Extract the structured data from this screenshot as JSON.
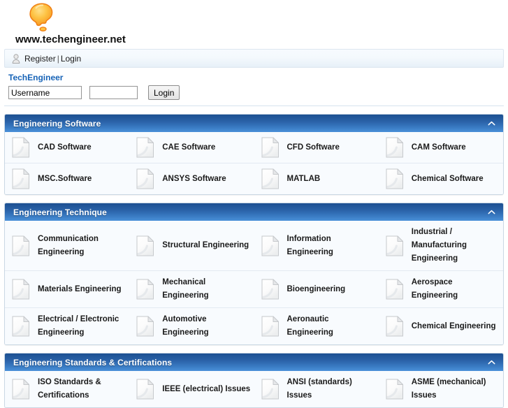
{
  "site": {
    "name": "www.techengineer.net",
    "logo_icon": "lightbulb-speech-bubble-logo",
    "brand_color": "#f7941e"
  },
  "account_bar": {
    "user_icon": "user-icon",
    "register_label": "Register",
    "separator": "|",
    "login_label": "Login"
  },
  "login_form": {
    "title": "TechEngineer",
    "username_value": "Username",
    "username_placeholder": "Username",
    "password_value": "",
    "password_placeholder": "",
    "submit_label": "Login"
  },
  "panels": [
    {
      "title": "Engineering Software",
      "collapse_icon": "chevron-up-icon",
      "rows": [
        [
          {
            "icon": "document-icon",
            "label": "CAD Software"
          },
          {
            "icon": "document-icon",
            "label": "CAE Software"
          },
          {
            "icon": "document-icon",
            "label": "CFD Software"
          },
          {
            "icon": "document-icon",
            "label": "CAM Software"
          }
        ],
        [
          {
            "icon": "document-icon",
            "label": "MSC.Software"
          },
          {
            "icon": "document-icon",
            "label": "ANSYS Software"
          },
          {
            "icon": "document-icon",
            "label": "MATLAB"
          },
          {
            "icon": "document-icon",
            "label": "Chemical Software"
          }
        ]
      ]
    },
    {
      "title": "Engineering Technique",
      "collapse_icon": "chevron-up-icon",
      "rows": [
        [
          {
            "icon": "document-icon",
            "label": "Communication\nEngineering"
          },
          {
            "icon": "document-icon",
            "label": "Structural Engineering"
          },
          {
            "icon": "document-icon",
            "label": "Information\nEngineering"
          },
          {
            "icon": "document-icon",
            "label": "Industrial /\nManufacturing\nEngineering"
          }
        ],
        [
          {
            "icon": "document-icon",
            "label": "Materials Engineering"
          },
          {
            "icon": "document-icon",
            "label": "Mechanical\nEngineering"
          },
          {
            "icon": "document-icon",
            "label": "Bioengineering"
          },
          {
            "icon": "document-icon",
            "label": "Aerospace Engineering"
          }
        ],
        [
          {
            "icon": "document-icon",
            "label": "Electrical / Electronic\nEngineering"
          },
          {
            "icon": "document-icon",
            "label": "Automotive\nEngineering"
          },
          {
            "icon": "document-icon",
            "label": "Aeronautic Engineering"
          },
          {
            "icon": "document-icon",
            "label": "Chemical Engineering"
          }
        ]
      ]
    },
    {
      "title": "Engineering Standards & Certifications",
      "collapse_icon": "chevron-up-icon",
      "rows": [
        [
          {
            "icon": "document-icon",
            "label": "ISO Standards &\nCertifications"
          },
          {
            "icon": "document-icon",
            "label": "IEEE (electrical) Issues"
          },
          {
            "icon": "document-icon",
            "label": "ANSI (standards)\nIssues"
          },
          {
            "icon": "document-icon",
            "label": "ASME (mechanical)\nIssues"
          }
        ]
      ]
    }
  ]
}
